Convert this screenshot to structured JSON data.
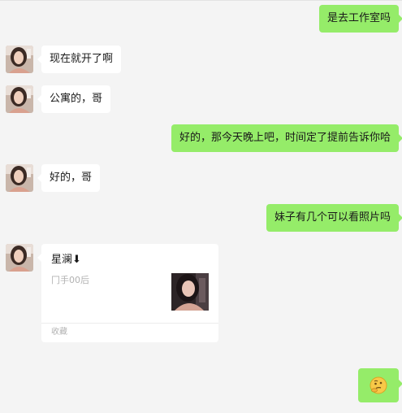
{
  "messages": [
    {
      "side": "right",
      "text": "是去工作室吗"
    },
    {
      "side": "left",
      "text": "现在就开了啊"
    },
    {
      "side": "left",
      "text": "公寓的，哥"
    },
    {
      "side": "right",
      "text": "好的，那今天晚上吧，时间定了提前告诉你哈"
    },
    {
      "side": "left",
      "text": "好的，哥"
    },
    {
      "side": "right",
      "text": "妹子有几个可以看照片吗"
    }
  ],
  "card": {
    "title": "星澜⬇",
    "subtitle": "冂手00后",
    "source": "收藏"
  },
  "emoji": {
    "icon": "thinking-face-emoji"
  },
  "colors": {
    "background": "#f4f4f4",
    "outgoing_bubble": "#95ec69",
    "incoming_bubble": "#ffffff",
    "muted_text": "#b2b2b2"
  }
}
